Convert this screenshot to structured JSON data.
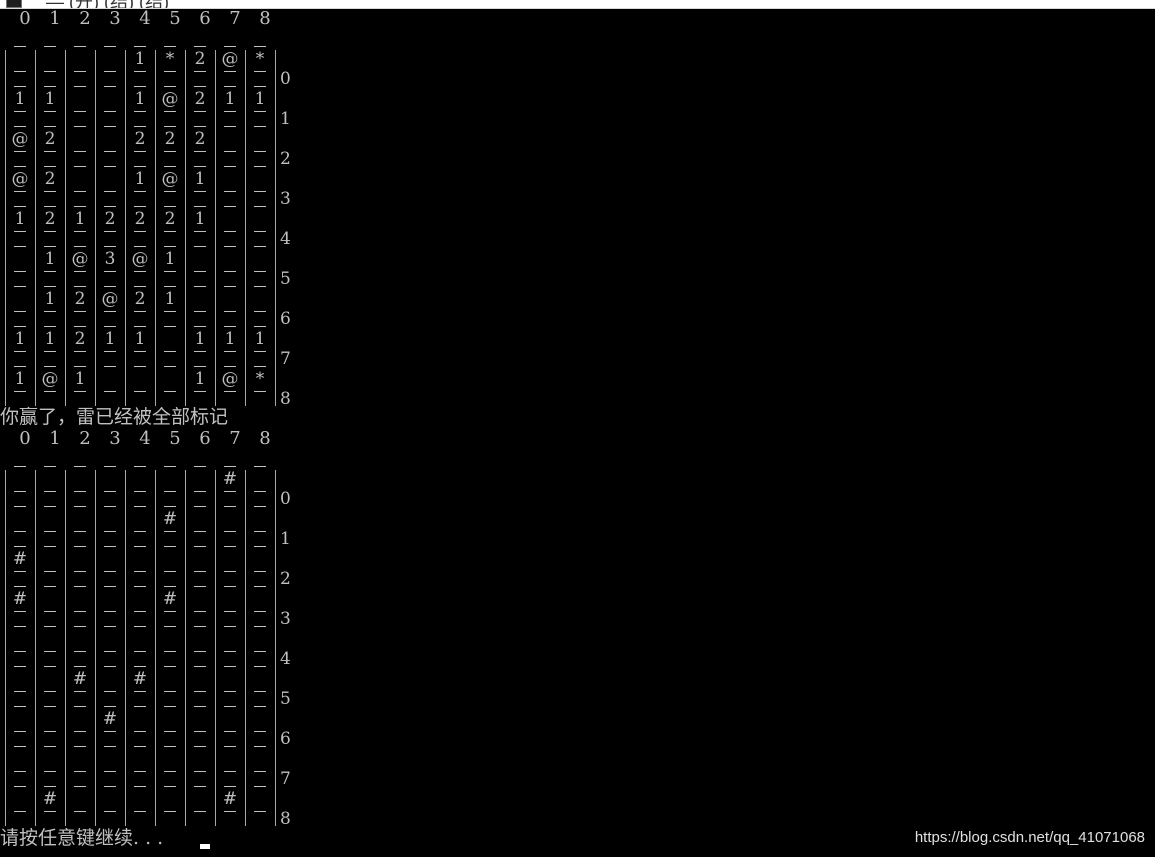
{
  "titlebar": {
    "text": "— (开) (结) (结)"
  },
  "columns": [
    "0",
    "1",
    "2",
    "3",
    "4",
    "5",
    "6",
    "7",
    "8"
  ],
  "rows": [
    "0",
    "1",
    "2",
    "3",
    "4",
    "5",
    "6",
    "7",
    "8"
  ],
  "board_revealed": [
    [
      "",
      "",
      "",
      "",
      "1",
      "*",
      "2",
      "@",
      "*"
    ],
    [
      "1",
      "1",
      "",
      "",
      "1",
      "@",
      "2",
      "1",
      "1"
    ],
    [
      "@",
      "2",
      "",
      "",
      "2",
      "2",
      "2",
      "",
      ""
    ],
    [
      "@",
      "2",
      "",
      "",
      "1",
      "@",
      "1",
      "",
      ""
    ],
    [
      "1",
      "2",
      "1",
      "2",
      "2",
      "2",
      "1",
      "",
      ""
    ],
    [
      "",
      "1",
      "@",
      "3",
      "@",
      "1",
      "",
      "",
      ""
    ],
    [
      "",
      "1",
      "2",
      "@",
      "2",
      "1",
      "",
      "",
      ""
    ],
    [
      "1",
      "1",
      "2",
      "1",
      "1",
      "",
      "1",
      "1",
      "1"
    ],
    [
      "1",
      "@",
      "1",
      "",
      "",
      "",
      "1",
      "@",
      "*"
    ]
  ],
  "win_message": "你赢了，雷已经被全部标记",
  "board_flags": [
    [
      "",
      "",
      "",
      "",
      "",
      "",
      "",
      "#",
      ""
    ],
    [
      "",
      "",
      "",
      "",
      "",
      "#",
      "",
      "",
      ""
    ],
    [
      "#",
      "",
      "",
      "",
      "",
      "",
      "",
      "",
      ""
    ],
    [
      "#",
      "",
      "",
      "",
      "",
      "#",
      "",
      "",
      ""
    ],
    [
      "",
      "",
      "",
      "",
      "",
      "",
      "",
      "",
      ""
    ],
    [
      "",
      "",
      "#",
      "",
      "#",
      "",
      "",
      "",
      ""
    ],
    [
      "",
      "",
      "",
      "#",
      "",
      "",
      "",
      "",
      ""
    ],
    [
      "",
      "",
      "",
      "",
      "",
      "",
      "",
      "",
      ""
    ],
    [
      "",
      "#",
      "",
      "",
      "",
      "",
      "",
      "#",
      ""
    ]
  ],
  "prompt": "请按任意键继续. . .",
  "watermark": "https://blog.csdn.net/qq_41071068"
}
